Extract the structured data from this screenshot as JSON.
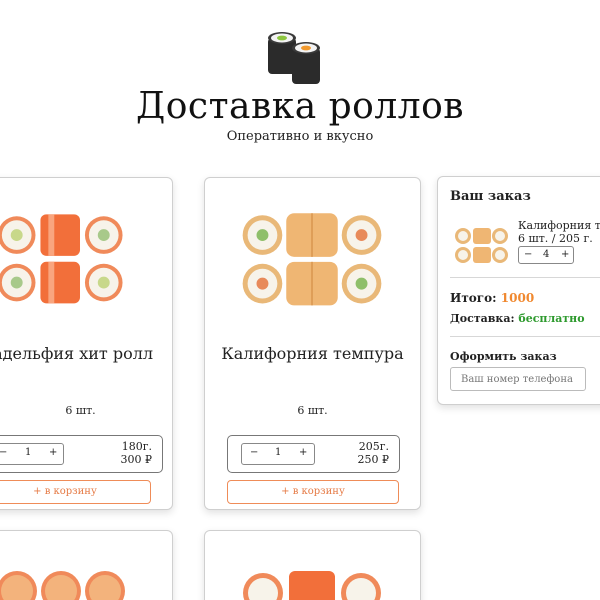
{
  "header": {
    "title": "Доставка роллов",
    "subtitle": "Оперативно и вкусно"
  },
  "products": [
    {
      "name": "Филадельфия хит ролл",
      "count": "6 шт.",
      "quantity": "1",
      "weight": "180г.",
      "price": "300 ₽",
      "cart_label": "+ в корзину",
      "minus": "−",
      "plus": "+"
    },
    {
      "name": "Калифорния темпура",
      "count": "6 шт.",
      "quantity": "1",
      "weight": "205г.",
      "price": "250 ₽",
      "cart_label": "+ в корзину",
      "minus": "−",
      "plus": "+"
    }
  ],
  "order": {
    "title": "Ваш заказ",
    "item_name": "Калифорния темпура",
    "item_meta": "6 шт. / 205 г.",
    "item_quantity": "4",
    "minus": "−",
    "plus": "+",
    "total_label": "Итого:",
    "total_value": "1000",
    "delivery_label": "Доставка:",
    "delivery_value": "бесплатно",
    "checkout_title": "Оформить заказ",
    "phone_placeholder": "Ваш номер телефона"
  },
  "colors": {
    "accent": "#e57a45",
    "total": "#f0882f",
    "free": "#2e9a2e"
  }
}
